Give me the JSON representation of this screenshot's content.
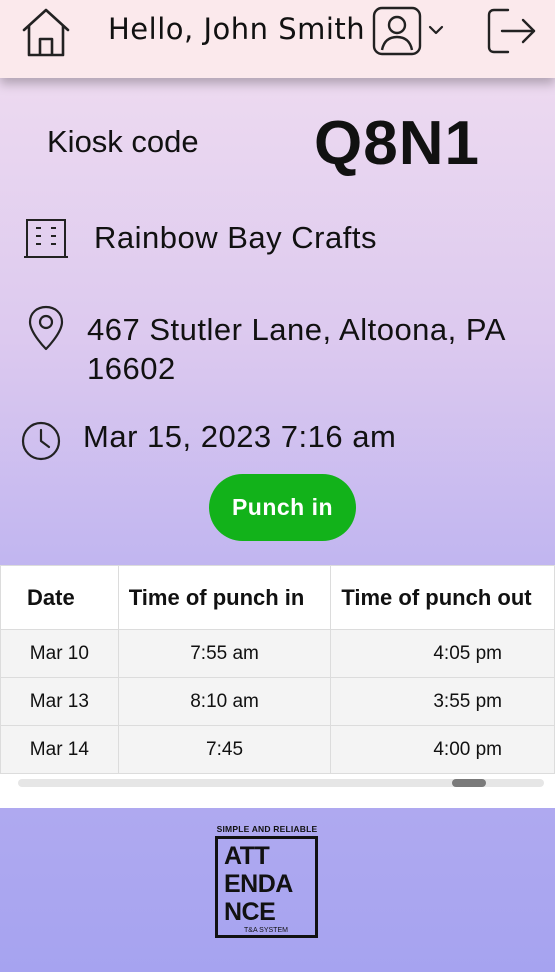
{
  "header": {
    "greeting": "Hello, John Smith",
    "icons": {
      "home": "home-icon",
      "avatar": "user-avatar-icon",
      "dropdown": "chevron-down-icon",
      "logout": "logout-icon"
    }
  },
  "kiosk": {
    "label": "Kiosk code",
    "code": "Q8N1"
  },
  "location": {
    "business_name": "Rainbow Bay Crafts",
    "address_line1": "467 Stutler Lane, Altoona, PA",
    "address_line2": "16602",
    "datetime": "Mar 15, 2023 7:16 am"
  },
  "punch_button": {
    "label": "Punch in",
    "color": "#12b21a"
  },
  "punches_table": {
    "columns": [
      "Date",
      "Time of punch in",
      "Time of punch out"
    ],
    "rows": [
      [
        "Mar 10",
        "7:55 am",
        "4:05 pm"
      ],
      [
        "Mar 13",
        "8:10 am",
        "3:55 pm"
      ],
      [
        "Mar 14",
        "7:45",
        "4:00 pm"
      ]
    ]
  },
  "logo": {
    "tagline": "SIMPLE AND RELIABLE",
    "lines": [
      "ATT",
      "ENDA",
      "NCE"
    ],
    "subtitle": "T&A SYSTEM"
  }
}
